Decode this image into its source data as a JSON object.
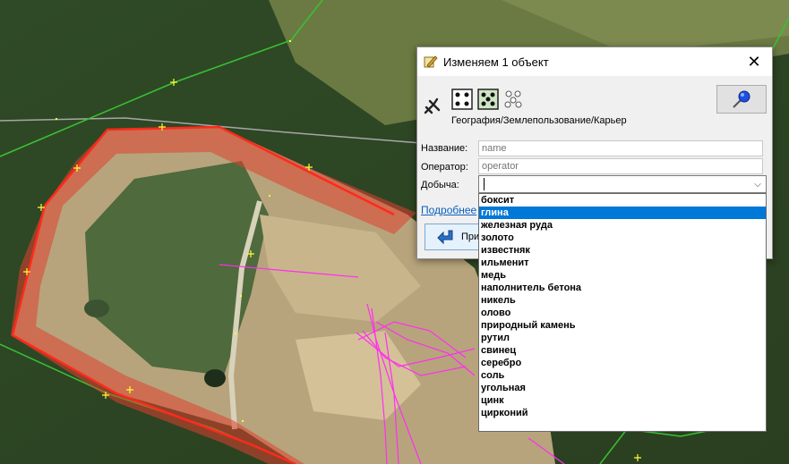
{
  "dialog": {
    "title": "Изменяем 1 объект",
    "preset_name": "География/Землепользование/Карьер",
    "close_glyph": "✕",
    "fields": [
      {
        "label": "Название:",
        "placeholder": "name"
      },
      {
        "label": "Оператор:",
        "placeholder": "operator"
      }
    ],
    "combo_label": "Добыча:",
    "combo_arrow": "⌵",
    "more_link": "Подробнее",
    "apply_label": "Применить"
  },
  "dropdown": {
    "selected_index": 1,
    "options": [
      "боксит",
      "глина",
      "железная руда",
      "золото",
      "известняк",
      "ильменит",
      "медь",
      "наполнитель бетона",
      "никель",
      "олово",
      "природный камень",
      "рутил",
      "свинец",
      "серебро",
      "соль",
      "угольная",
      "цинк",
      "цирконий"
    ]
  },
  "colors": {
    "selection": "#0078d7",
    "area_outline": "#ff2a1a",
    "area_fill": "#e04030",
    "way_green": "#39c234",
    "way_magenta": "#ff2ef0",
    "node_yellow": "#ffff33"
  },
  "icons": [
    "app-icon",
    "close-icon",
    "pick-icon",
    "nodes-icon",
    "nodes-selected-icon",
    "relation-icon",
    "pin-icon",
    "apply-arrow-icon",
    "dropdown-arrow-icon"
  ]
}
